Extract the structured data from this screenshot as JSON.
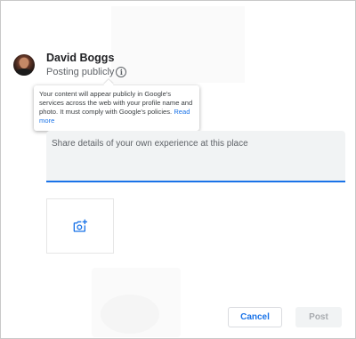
{
  "user": {
    "name": "David Boggs",
    "posting_status": "Posting publicly"
  },
  "tooltip": {
    "text": "Your content will appear publicly in Google's services across the web with your profile name and photo. It must comply with Google's policies.",
    "link_label": "Read more"
  },
  "review": {
    "placeholder": "Share details of your own experience at this place",
    "value": ""
  },
  "photo_tile": {
    "icon": "add-photo-icon"
  },
  "actions": {
    "cancel_label": "Cancel",
    "post_label": "Post"
  },
  "colors": {
    "accent": "#1a73e8",
    "input_background": "#f1f3f4",
    "disabled_text": "#a8abaf"
  }
}
